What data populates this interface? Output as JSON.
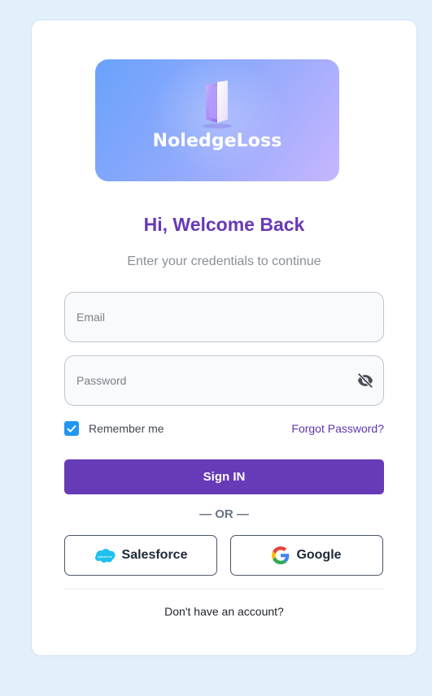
{
  "brand": {
    "logo_text": "NoledgeLoss"
  },
  "header": {
    "title": "Hi, Welcome Back",
    "subtitle": "Enter your credentials to continue"
  },
  "form": {
    "email": {
      "value": "",
      "placeholder": "Email"
    },
    "password": {
      "value": "",
      "placeholder": "Password",
      "toggle_icon": "eye-off-icon"
    },
    "remember_me": {
      "label": "Remember me",
      "checked": true
    },
    "forgot_password_label": "Forgot Password?",
    "submit_label": "Sign IN"
  },
  "divider_text": "— OR —",
  "social": {
    "salesforce_label": "Salesforce",
    "google_label": "Google"
  },
  "footer": {
    "signup_text": "Don't have an account?"
  },
  "colors": {
    "page_background": "#e3f0fc",
    "accent": "#673ab7",
    "checkbox": "#2196f3",
    "link": "#5e35b1"
  }
}
